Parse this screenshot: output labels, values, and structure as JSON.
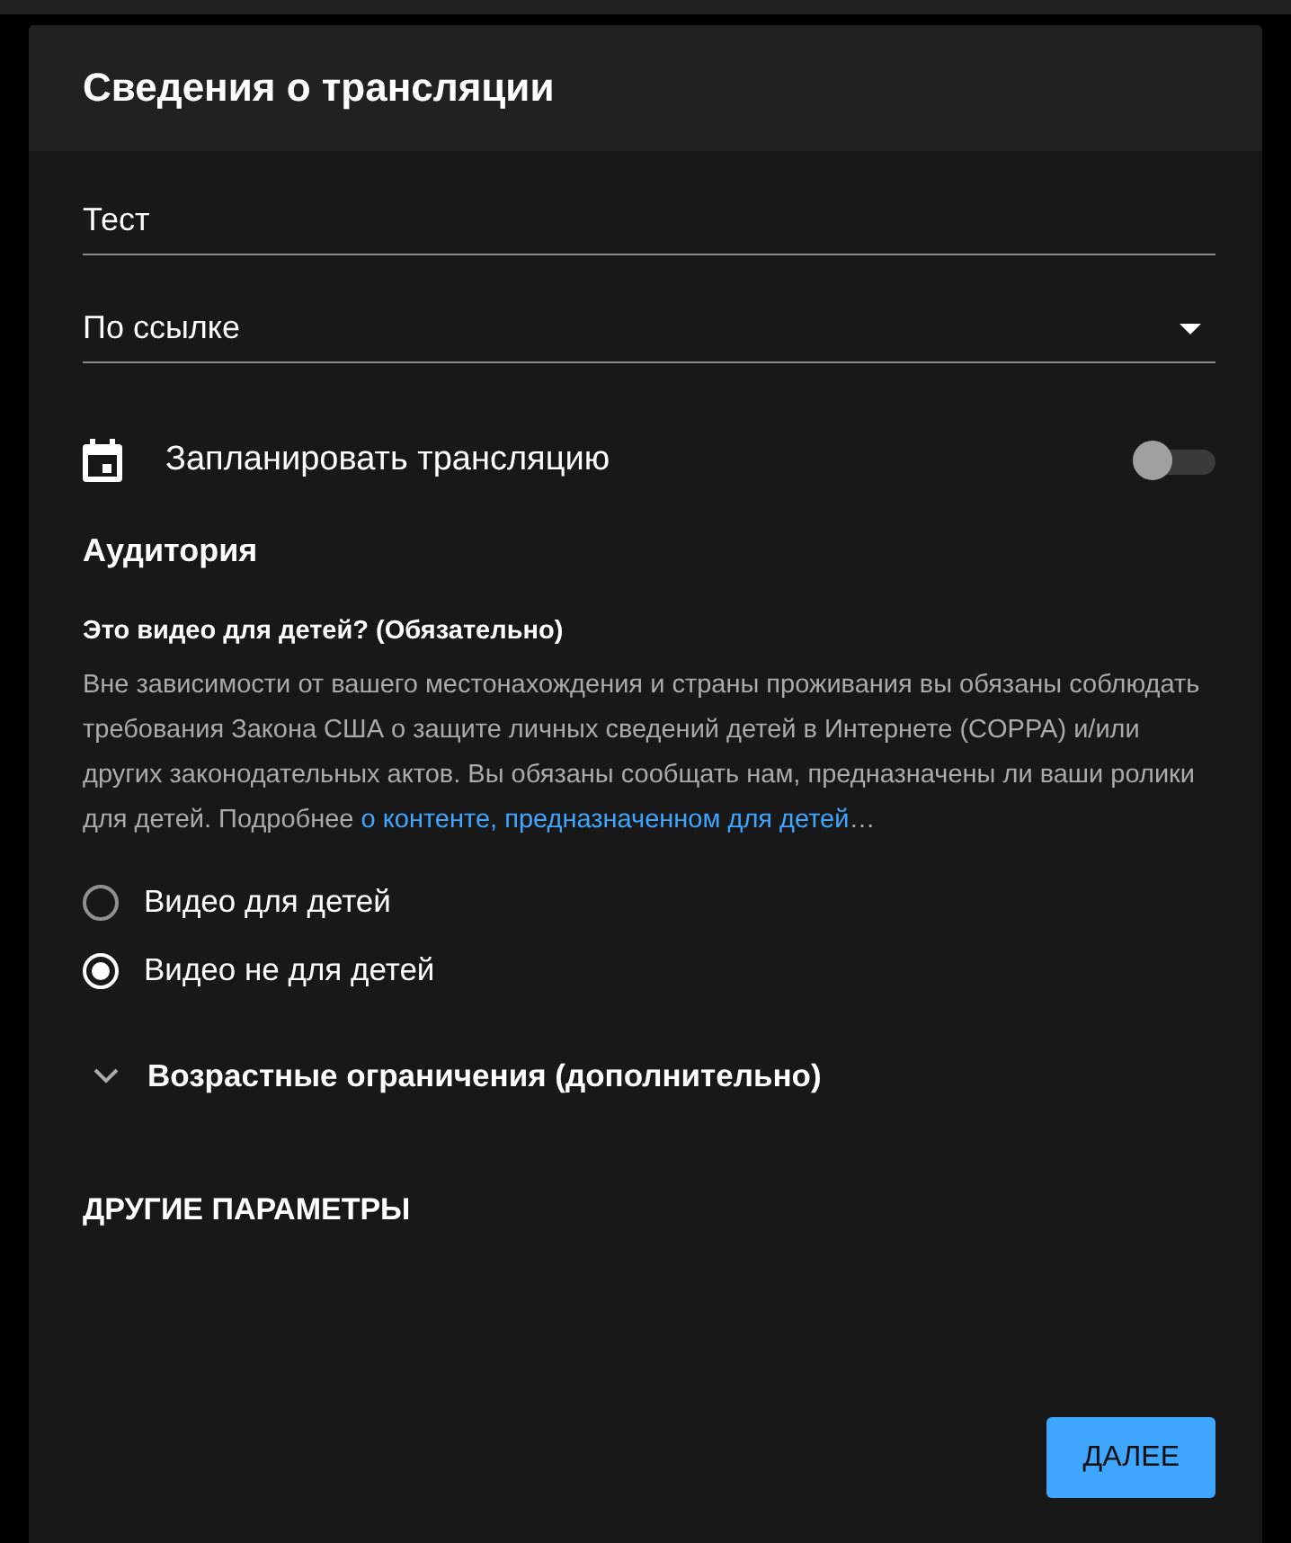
{
  "dialog": {
    "title": "Сведения о трансляции"
  },
  "title_field": {
    "value": "Тест"
  },
  "visibility_dropdown": {
    "value": "По ссылке"
  },
  "schedule": {
    "label": "Запланировать трансляцию",
    "on": false
  },
  "audience": {
    "heading": "Аудитория",
    "question": "Это видео для детей? (Обязательно)",
    "description": "Вне зависимости от вашего местонахождения и страны проживания вы обязаны соблюдать требования Закона США о защите личных сведений детей в Интернете (COPPA) и/или других законодательных актов. Вы обязаны сообщать нам, предназначены ли ваши ролики для детей. Подробнее ",
    "link": "о контенте, предназначенном для детей",
    "suffix": "…",
    "options": [
      {
        "label": "Видео для детей",
        "selected": false
      },
      {
        "label": "Видео не для детей",
        "selected": true
      }
    ]
  },
  "age_restrictions": {
    "label": "Возрастные ограничения (дополнительно)",
    "expanded": false
  },
  "other_settings": {
    "label": "ДРУГИЕ ПАРАМЕТРЫ"
  },
  "buttons": [
    {
      "label": "ДАЛЕЕ"
    }
  ]
}
